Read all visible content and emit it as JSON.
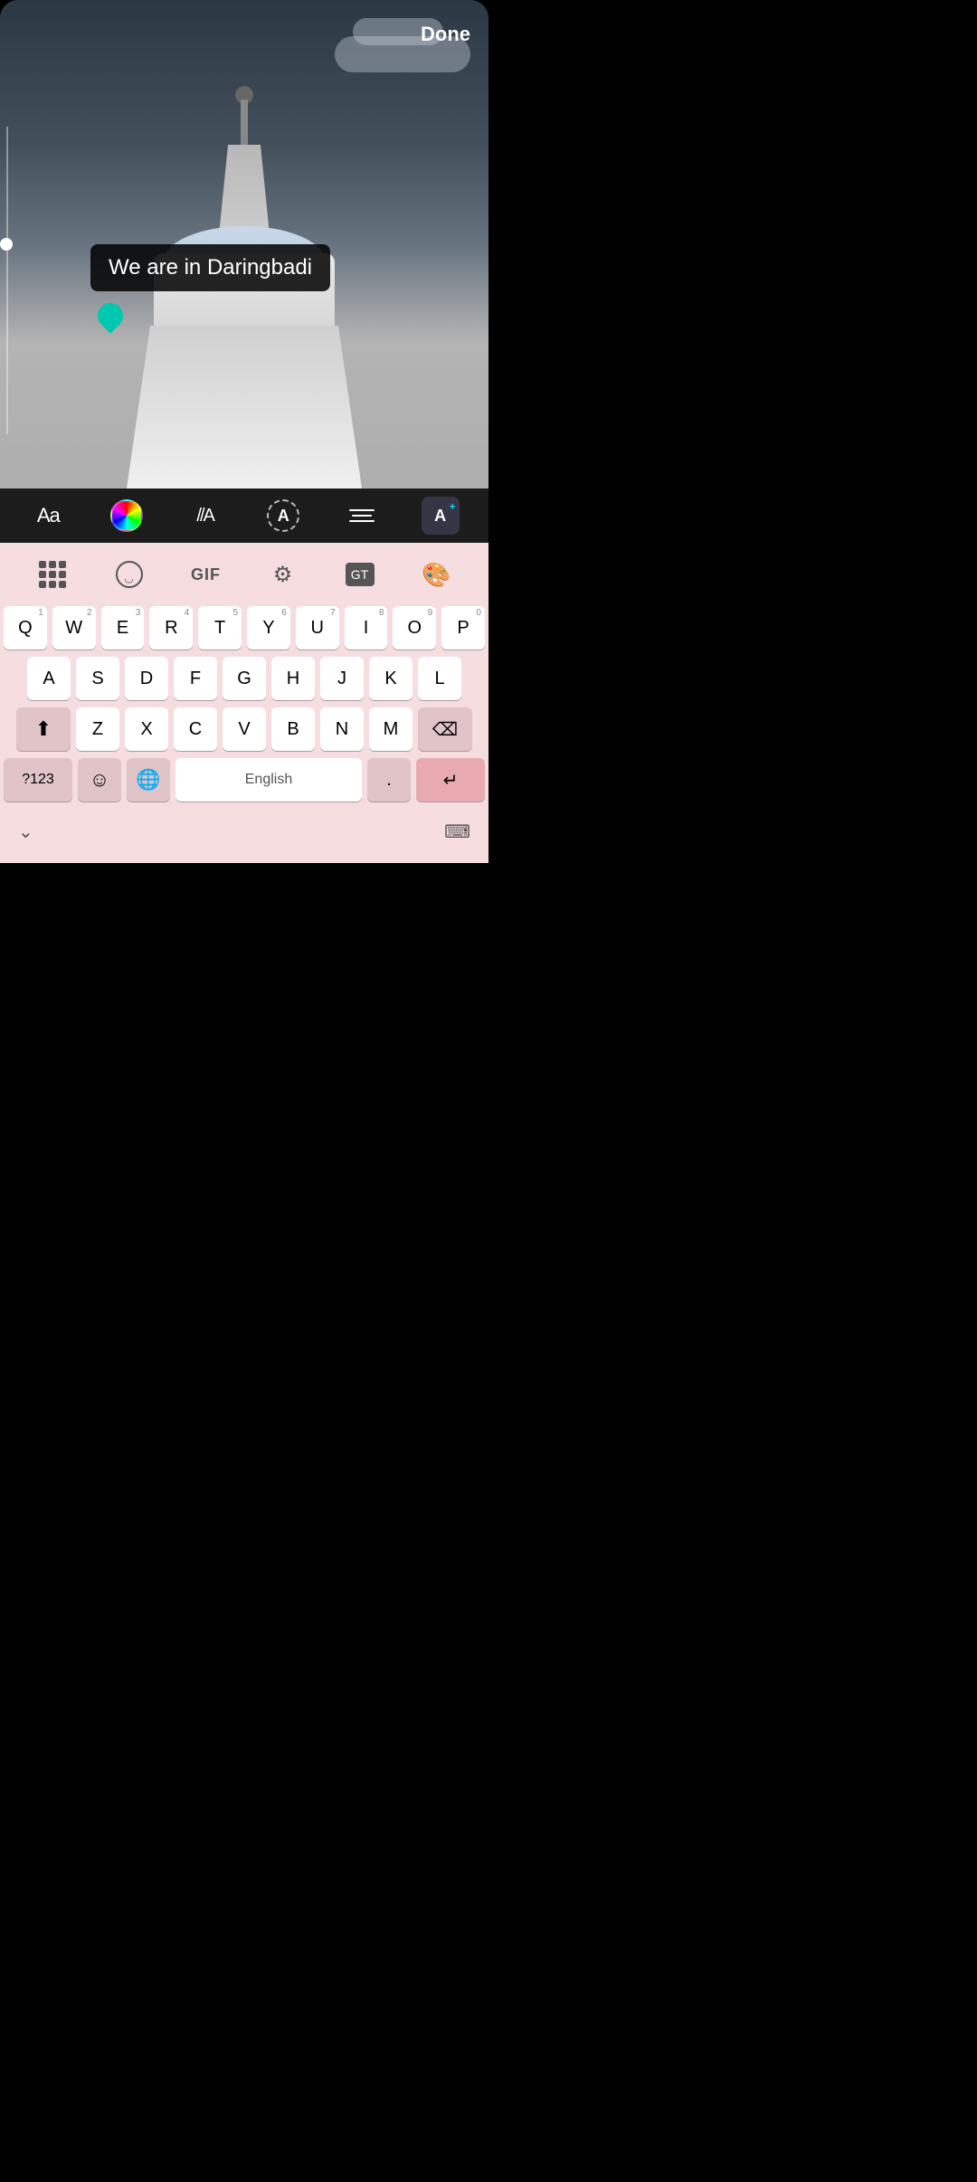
{
  "header": {
    "done_label": "Done"
  },
  "text_overlay": {
    "content": "We are in Daringbadi"
  },
  "toolbar": {
    "aa_label": "Aa",
    "slash_label": "//A",
    "a_circle_label": "A",
    "a_plus_label": "A"
  },
  "keyboard": {
    "icons": {
      "gif_label": "GIF",
      "translate_label": "GT"
    },
    "rows": [
      [
        "Q",
        "W",
        "E",
        "R",
        "T",
        "Y",
        "U",
        "I",
        "O",
        "P"
      ],
      [
        "A",
        "S",
        "D",
        "F",
        "G",
        "H",
        "J",
        "K",
        "L"
      ],
      [
        "Z",
        "X",
        "C",
        "V",
        "B",
        "N",
        "M"
      ]
    ],
    "numbers": [
      "1",
      "2",
      "3",
      "4",
      "5",
      "6",
      "7",
      "8",
      "9",
      "0"
    ],
    "special": {
      "num_label": "?123",
      "space_label": "English",
      "period_label": ".",
      "return_label": "↵"
    }
  },
  "bottom": {
    "chevron": "⌄",
    "keyboard_icon": "⌨"
  }
}
